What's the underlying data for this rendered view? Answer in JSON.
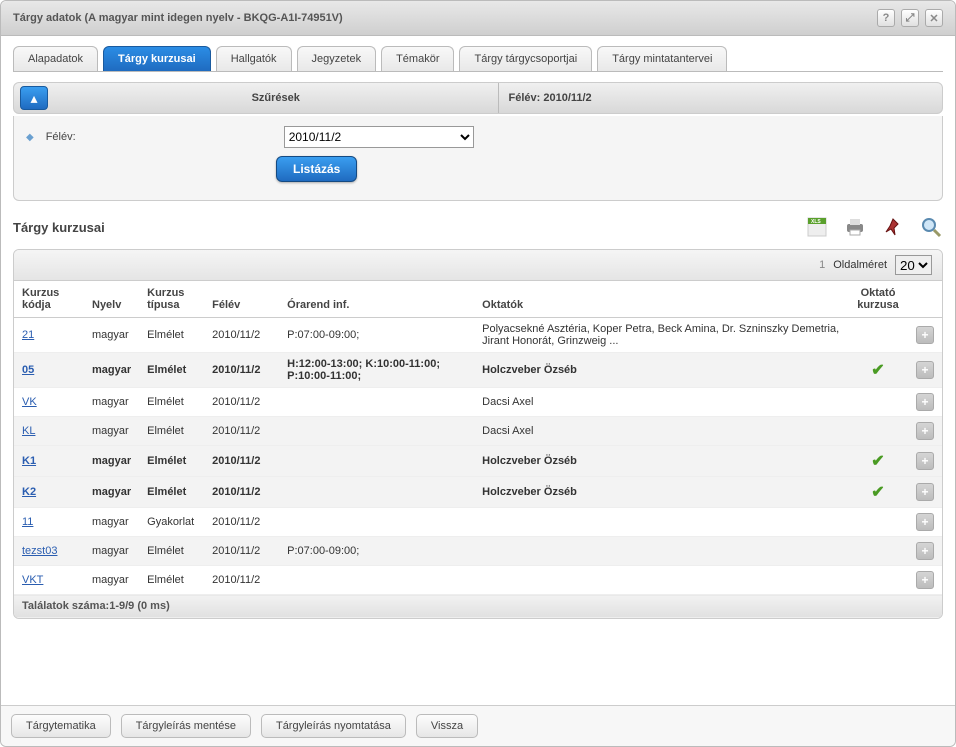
{
  "window": {
    "title": "Tárgy adatok (A magyar mint idegen nyelv - BKQG-A1I-74951V)"
  },
  "tabs": [
    {
      "label": "Alapadatok"
    },
    {
      "label": "Tárgy kurzusai"
    },
    {
      "label": "Hallgatók"
    },
    {
      "label": "Jegyzetek"
    },
    {
      "label": "Témakör"
    },
    {
      "label": "Tárgy tárgycsoportjai"
    },
    {
      "label": "Tárgy mintatantervei"
    }
  ],
  "active_tab": 1,
  "filter": {
    "heading_left": "Szűrések",
    "heading_right": "Félév: 2010/11/2",
    "field_label": "Félév:",
    "selected": "2010/11/2",
    "button": "Listázás"
  },
  "section_title": "Tárgy kurzusai",
  "pager": {
    "page": "1",
    "size_label": "Oldalméret",
    "size": "20"
  },
  "columns": {
    "code": "Kurzus kódja",
    "lang": "Nyelv",
    "type": "Kurzus típusa",
    "sem": "Félév",
    "sched": "Órarend inf.",
    "teachers": "Oktatók",
    "own": "Oktató kurzusa"
  },
  "rows": [
    {
      "code": "21",
      "lang": "magyar",
      "type": "Elmélet",
      "sem": "2010/11/2",
      "sched": "P:07:00-09:00;",
      "teachers": "Polyacsekné Asztéria, Koper Petra, Beck Amina, Dr. Szninszky Demetria, Jirant Honorát, Grinzweig ...",
      "own": false,
      "bold": false
    },
    {
      "code": "05",
      "lang": "magyar",
      "type": "Elmélet",
      "sem": "2010/11/2",
      "sched": "H:12:00-13:00; K:10:00-11:00; P:10:00-11:00;",
      "teachers": "Holczveber Özséb",
      "own": true,
      "bold": true
    },
    {
      "code": "VK",
      "lang": "magyar",
      "type": "Elmélet",
      "sem": "2010/11/2",
      "sched": "",
      "teachers": "Dacsi Axel",
      "own": false,
      "bold": false
    },
    {
      "code": "KL",
      "lang": "magyar",
      "type": "Elmélet",
      "sem": "2010/11/2",
      "sched": "",
      "teachers": "Dacsi Axel",
      "own": false,
      "bold": false
    },
    {
      "code": "K1",
      "lang": "magyar",
      "type": "Elmélet",
      "sem": "2010/11/2",
      "sched": "",
      "teachers": "Holczveber Özséb",
      "own": true,
      "bold": true
    },
    {
      "code": "K2",
      "lang": "magyar",
      "type": "Elmélet",
      "sem": "2010/11/2",
      "sched": "",
      "teachers": "Holczveber Özséb",
      "own": true,
      "bold": true
    },
    {
      "code": "11",
      "lang": "magyar",
      "type": "Gyakorlat",
      "sem": "2010/11/2",
      "sched": "",
      "teachers": "",
      "own": false,
      "bold": false
    },
    {
      "code": "tezst03",
      "lang": "magyar",
      "type": "Elmélet",
      "sem": "2010/11/2",
      "sched": "P:07:00-09:00;",
      "teachers": "",
      "own": false,
      "bold": false
    },
    {
      "code": "VKT",
      "lang": "magyar",
      "type": "Elmélet",
      "sem": "2010/11/2",
      "sched": "",
      "teachers": "",
      "own": false,
      "bold": false
    }
  ],
  "footer_text": "Találatok száma:1-9/9 (0 ms)",
  "bottom_buttons": [
    "Tárgytematika",
    "Tárgyleírás mentése",
    "Tárgyleírás nyomtatása",
    "Vissza"
  ]
}
